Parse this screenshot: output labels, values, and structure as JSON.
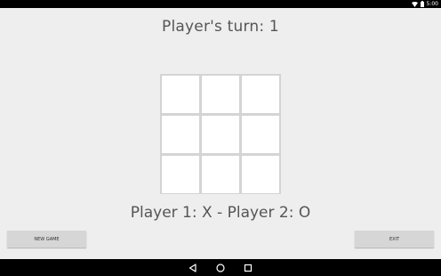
{
  "status_bar": {
    "time": "5:00"
  },
  "game": {
    "turn_label": "Player's turn: 1",
    "board": [
      "",
      "",
      "",
      "",
      "",
      "",
      "",
      "",
      ""
    ],
    "players_label": "Player 1: X - Player 2: O"
  },
  "buttons": {
    "new_game": "NEW GAME",
    "exit": "EXIT"
  },
  "icons": {
    "wifi": "wifi-icon",
    "battery": "battery-icon",
    "back": "back-icon",
    "home": "home-icon",
    "recents": "recents-icon"
  }
}
